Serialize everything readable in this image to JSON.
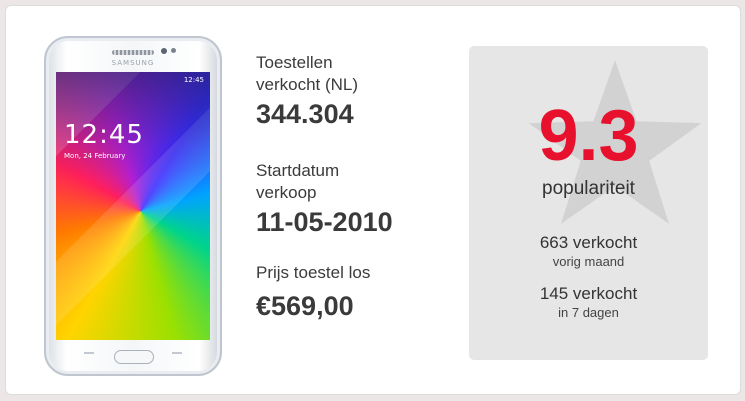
{
  "phone": {
    "brand": "SAMSUNG",
    "status_time": "12:45",
    "clock": "12:45",
    "date": "Mon, 24 February"
  },
  "stats": {
    "sold_label": "Toestellen verkocht (NL)",
    "sold_value": "344.304",
    "start_label": "Startdatum verkoop",
    "start_value": "11-05-2010",
    "price_label": "Prijs toestel los",
    "price_value": "€569,00"
  },
  "popularity": {
    "score": "9.3",
    "label": "populariteit",
    "month_count": "663 verkocht",
    "month_period": "vorig maand",
    "week_count": "145 verkocht",
    "week_period": "in 7 dagen"
  },
  "colors": {
    "score": "#e8112d",
    "panel": "#e6e6e6",
    "background": "#ece6e6"
  }
}
